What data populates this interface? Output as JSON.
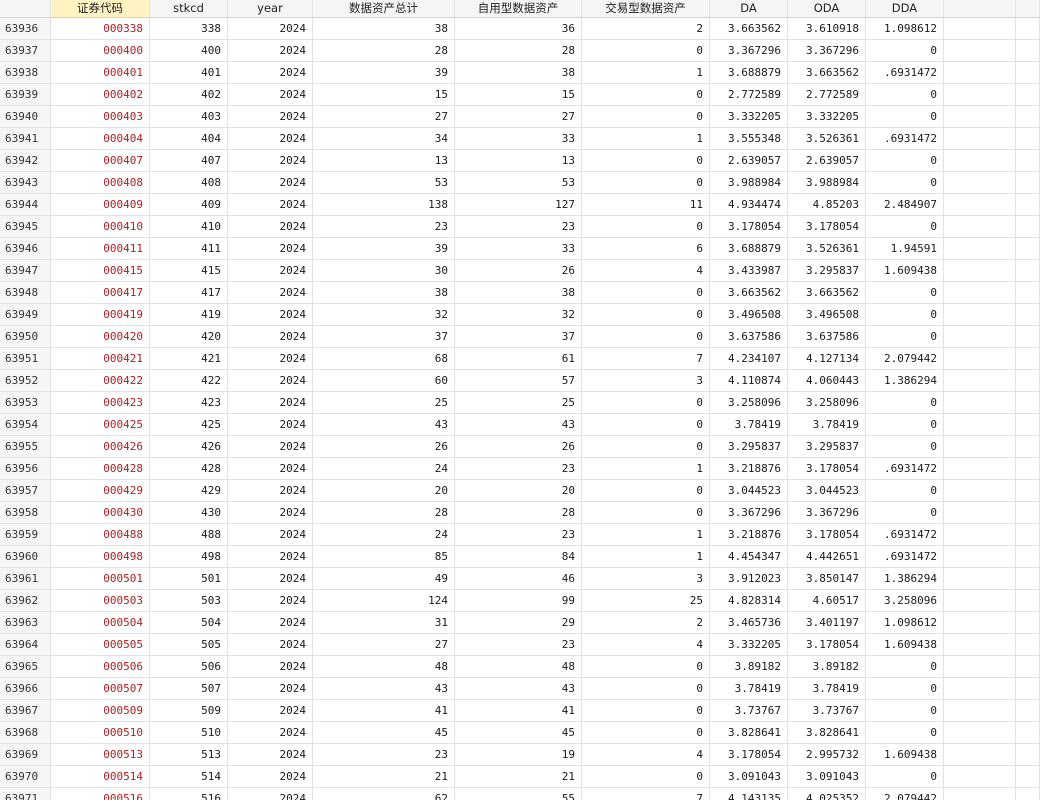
{
  "columns": [
    "",
    "证券代码",
    "stkcd",
    "year",
    "数据资产总计",
    "自用型数据资产",
    "交易型数据资产",
    "DA",
    "ODA",
    "DDA"
  ],
  "rows": [
    [
      "63936",
      "000338",
      "338",
      "2024",
      "38",
      "36",
      "2",
      "3.663562",
      "3.610918",
      "1.098612"
    ],
    [
      "63937",
      "000400",
      "400",
      "2024",
      "28",
      "28",
      "0",
      "3.367296",
      "3.367296",
      "0"
    ],
    [
      "63938",
      "000401",
      "401",
      "2024",
      "39",
      "38",
      "1",
      "3.688879",
      "3.663562",
      ".6931472"
    ],
    [
      "63939",
      "000402",
      "402",
      "2024",
      "15",
      "15",
      "0",
      "2.772589",
      "2.772589",
      "0"
    ],
    [
      "63940",
      "000403",
      "403",
      "2024",
      "27",
      "27",
      "0",
      "3.332205",
      "3.332205",
      "0"
    ],
    [
      "63941",
      "000404",
      "404",
      "2024",
      "34",
      "33",
      "1",
      "3.555348",
      "3.526361",
      ".6931472"
    ],
    [
      "63942",
      "000407",
      "407",
      "2024",
      "13",
      "13",
      "0",
      "2.639057",
      "2.639057",
      "0"
    ],
    [
      "63943",
      "000408",
      "408",
      "2024",
      "53",
      "53",
      "0",
      "3.988984",
      "3.988984",
      "0"
    ],
    [
      "63944",
      "000409",
      "409",
      "2024",
      "138",
      "127",
      "11",
      "4.934474",
      "4.85203",
      "2.484907"
    ],
    [
      "63945",
      "000410",
      "410",
      "2024",
      "23",
      "23",
      "0",
      "3.178054",
      "3.178054",
      "0"
    ],
    [
      "63946",
      "000411",
      "411",
      "2024",
      "39",
      "33",
      "6",
      "3.688879",
      "3.526361",
      "1.94591"
    ],
    [
      "63947",
      "000415",
      "415",
      "2024",
      "30",
      "26",
      "4",
      "3.433987",
      "3.295837",
      "1.609438"
    ],
    [
      "63948",
      "000417",
      "417",
      "2024",
      "38",
      "38",
      "0",
      "3.663562",
      "3.663562",
      "0"
    ],
    [
      "63949",
      "000419",
      "419",
      "2024",
      "32",
      "32",
      "0",
      "3.496508",
      "3.496508",
      "0"
    ],
    [
      "63950",
      "000420",
      "420",
      "2024",
      "37",
      "37",
      "0",
      "3.637586",
      "3.637586",
      "0"
    ],
    [
      "63951",
      "000421",
      "421",
      "2024",
      "68",
      "61",
      "7",
      "4.234107",
      "4.127134",
      "2.079442"
    ],
    [
      "63952",
      "000422",
      "422",
      "2024",
      "60",
      "57",
      "3",
      "4.110874",
      "4.060443",
      "1.386294"
    ],
    [
      "63953",
      "000423",
      "423",
      "2024",
      "25",
      "25",
      "0",
      "3.258096",
      "3.258096",
      "0"
    ],
    [
      "63954",
      "000425",
      "425",
      "2024",
      "43",
      "43",
      "0",
      "3.78419",
      "3.78419",
      "0"
    ],
    [
      "63955",
      "000426",
      "426",
      "2024",
      "26",
      "26",
      "0",
      "3.295837",
      "3.295837",
      "0"
    ],
    [
      "63956",
      "000428",
      "428",
      "2024",
      "24",
      "23",
      "1",
      "3.218876",
      "3.178054",
      ".6931472"
    ],
    [
      "63957",
      "000429",
      "429",
      "2024",
      "20",
      "20",
      "0",
      "3.044523",
      "3.044523",
      "0"
    ],
    [
      "63958",
      "000430",
      "430",
      "2024",
      "28",
      "28",
      "0",
      "3.367296",
      "3.367296",
      "0"
    ],
    [
      "63959",
      "000488",
      "488",
      "2024",
      "24",
      "23",
      "1",
      "3.218876",
      "3.178054",
      ".6931472"
    ],
    [
      "63960",
      "000498",
      "498",
      "2024",
      "85",
      "84",
      "1",
      "4.454347",
      "4.442651",
      ".6931472"
    ],
    [
      "63961",
      "000501",
      "501",
      "2024",
      "49",
      "46",
      "3",
      "3.912023",
      "3.850147",
      "1.386294"
    ],
    [
      "63962",
      "000503",
      "503",
      "2024",
      "124",
      "99",
      "25",
      "4.828314",
      "4.60517",
      "3.258096"
    ],
    [
      "63963",
      "000504",
      "504",
      "2024",
      "31",
      "29",
      "2",
      "3.465736",
      "3.401197",
      "1.098612"
    ],
    [
      "63964",
      "000505",
      "505",
      "2024",
      "27",
      "23",
      "4",
      "3.332205",
      "3.178054",
      "1.609438"
    ],
    [
      "63965",
      "000506",
      "506",
      "2024",
      "48",
      "48",
      "0",
      "3.89182",
      "3.89182",
      "0"
    ],
    [
      "63966",
      "000507",
      "507",
      "2024",
      "43",
      "43",
      "0",
      "3.78419",
      "3.78419",
      "0"
    ],
    [
      "63967",
      "000509",
      "509",
      "2024",
      "41",
      "41",
      "0",
      "3.73767",
      "3.73767",
      "0"
    ],
    [
      "63968",
      "000510",
      "510",
      "2024",
      "45",
      "45",
      "0",
      "3.828641",
      "3.828641",
      "0"
    ],
    [
      "63969",
      "000513",
      "513",
      "2024",
      "23",
      "19",
      "4",
      "3.178054",
      "2.995732",
      "1.609438"
    ],
    [
      "63970",
      "000514",
      "514",
      "2024",
      "21",
      "21",
      "0",
      "3.091043",
      "3.091043",
      "0"
    ],
    [
      "63971",
      "000516",
      "516",
      "2024",
      "62",
      "55",
      "7",
      "4.143135",
      "4.025352",
      "2.079442"
    ]
  ],
  "colors": {
    "code_text": "#b01e1e",
    "selected_header": "#fff3c4",
    "header_bg": "#f5f5f5",
    "grid_line": "#e2e2e2"
  }
}
